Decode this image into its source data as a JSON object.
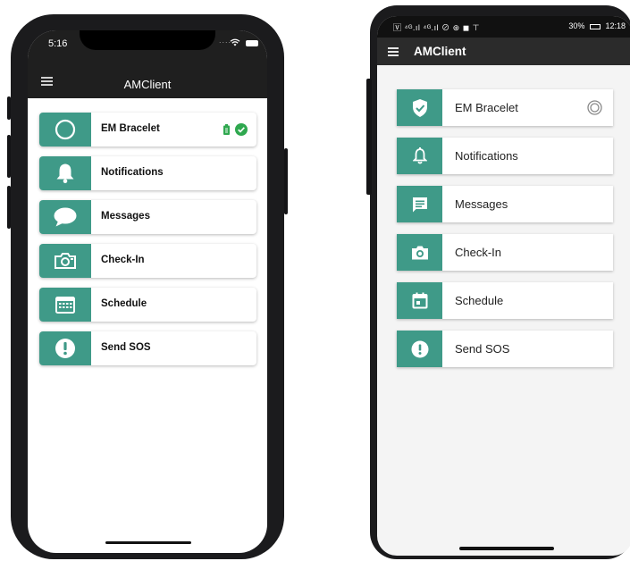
{
  "colors": {
    "accent": "#3f9a88",
    "status_ok": "#2fa84f"
  },
  "ios": {
    "status": {
      "time": "5:16",
      "signal_dots": "...."
    },
    "header": {
      "title": "AMClient"
    },
    "items": [
      {
        "label": "EM Bracelet",
        "icon": "circle-icon"
      },
      {
        "label": "Notifications",
        "icon": "bell-icon"
      },
      {
        "label": "Messages",
        "icon": "chat-bubble-icon"
      },
      {
        "label": "Check-In",
        "icon": "camera-icon"
      },
      {
        "label": "Schedule",
        "icon": "calendar-icon"
      },
      {
        "label": "Send SOS",
        "icon": "alert-icon"
      }
    ]
  },
  "android": {
    "status": {
      "left": "🅅 ⁴ᴳ.ıl ⁴ᴳ.ıl ⊘ ⊛ ◼ ⊤",
      "battery": "30%",
      "time": "12:18"
    },
    "header": {
      "title": "AMClient"
    },
    "items": [
      {
        "label": "EM Bracelet",
        "icon": "shield-check-icon"
      },
      {
        "label": "Notifications",
        "icon": "bell-outline-icon"
      },
      {
        "label": "Messages",
        "icon": "message-icon"
      },
      {
        "label": "Check-In",
        "icon": "camera-icon"
      },
      {
        "label": "Schedule",
        "icon": "calendar-icon"
      },
      {
        "label": "Send SOS",
        "icon": "alert-icon"
      }
    ]
  }
}
